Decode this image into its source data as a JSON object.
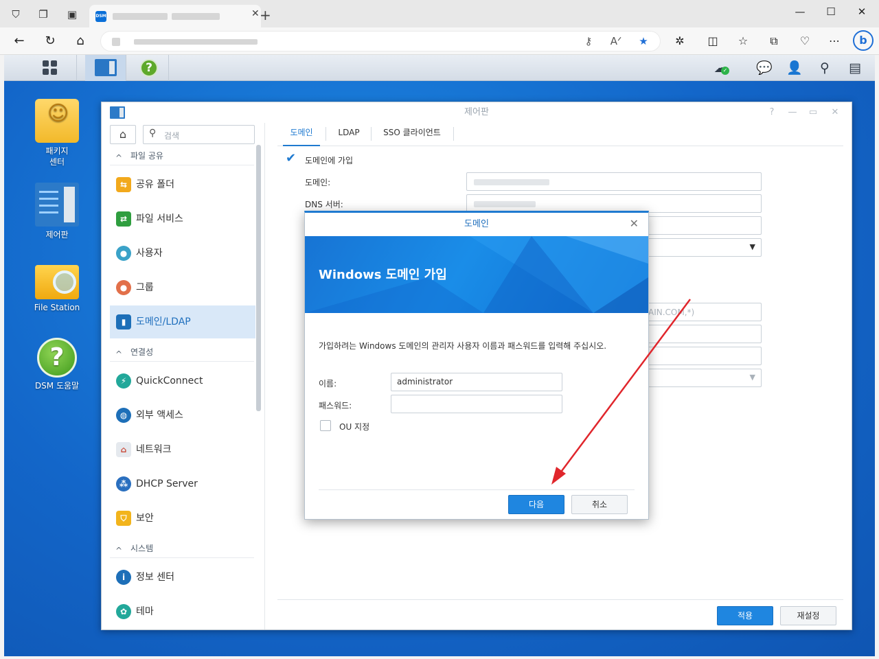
{
  "browser": {
    "tab_favicon": "DSM",
    "tab_close": "✕",
    "new_tab": "+",
    "icons": [
      "shield-icon",
      "collections-icon",
      "tab-icon",
      "back-icon",
      "refresh-icon",
      "home-icon",
      "key-icon",
      "read-aloud-icon",
      "favorite-star-icon",
      "extensions-icon",
      "split-screen-icon",
      "favorites-icon",
      "collections-add-icon",
      "heart-pulse-icon",
      "more-icon",
      "bing-icon"
    ],
    "bing_label": "b"
  },
  "desktop": {
    "items": [
      {
        "label": "패키지\n센터",
        "icon": "package-center-icon"
      },
      {
        "label": "제어판",
        "icon": "control-panel-icon"
      },
      {
        "label": "File Station",
        "icon": "file-station-icon"
      },
      {
        "label": "DSM 도움말",
        "icon": "dsm-help-icon"
      }
    ]
  },
  "control_panel": {
    "title": "제어판",
    "window_controls": [
      "?",
      "—",
      "▭",
      "✕"
    ],
    "search_placeholder": "검색",
    "sections": [
      {
        "label": "파일 공유",
        "items": [
          "공유 폴더",
          "파일 서비스",
          "사용자",
          "그룹",
          "도메인/LDAP"
        ]
      },
      {
        "label": "연결성",
        "items": [
          "QuickConnect",
          "외부 액세스",
          "네트워크",
          "DHCP Server",
          "보안"
        ]
      },
      {
        "label": "시스템",
        "items": [
          "정보 센터",
          "테마"
        ]
      }
    ],
    "active_item": "도메인/LDAP",
    "tabs": [
      "도메인",
      "LDAP",
      "SSO 클라이언트"
    ],
    "active_tab": "도메인",
    "join_domain_label": "도메인에 가입",
    "domain_label": "도메인:",
    "dns_label": "DNS 서버:",
    "partial_placeholder": "AIN.COM,*)",
    "apply_button": "적용",
    "reset_button": "재설정",
    "accent_color": "#1f7ad0"
  },
  "modal": {
    "title": "도메인",
    "close": "✕",
    "banner_title": "Windows 도메인 가입",
    "description": "가입하려는 Windows 도메인의 관리자 사용자 이름과 패스워드를 입력해 주십시오.",
    "name_label": "이름:",
    "name_value": "administrator",
    "password_label": "패스워드:",
    "password_value": "",
    "ou_label": "OU 지정",
    "next_button": "다음",
    "cancel_button": "취소"
  },
  "annotation": {
    "type": "red-arrow",
    "color": "#e0262c",
    "points_to": "next-button"
  }
}
